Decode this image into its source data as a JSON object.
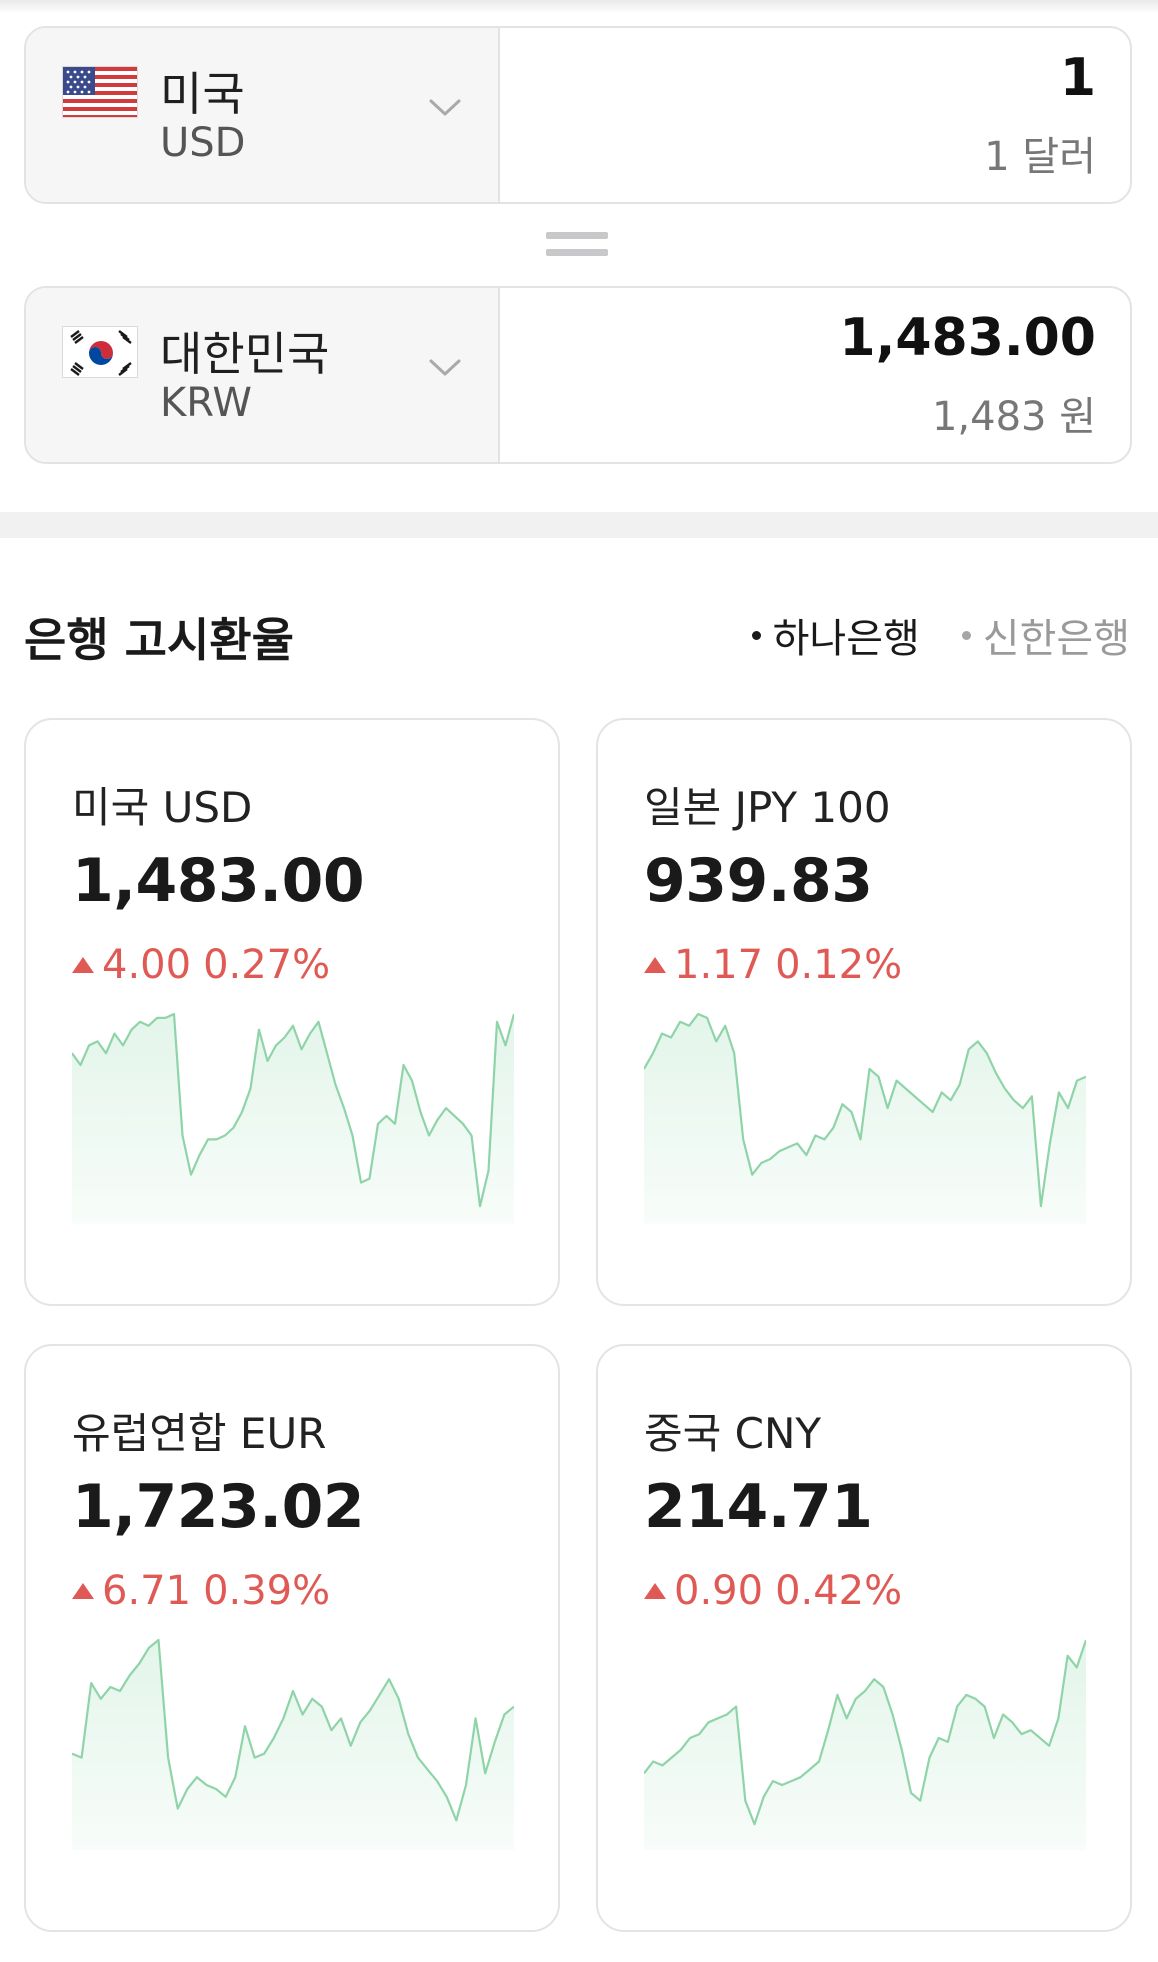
{
  "converter": {
    "from": {
      "country": "미국",
      "code": "USD",
      "amount": "1",
      "amount_text": "1 달러",
      "flag_icon": "us-flag-icon"
    },
    "to": {
      "country": "대한민국",
      "code": "KRW",
      "amount": "1,483.00",
      "amount_text": "1,483 원",
      "flag_icon": "kr-flag-icon"
    }
  },
  "rates_section": {
    "title": "은행 고시환율",
    "banks": [
      {
        "label": "하나은행",
        "active": true
      },
      {
        "label": "신한은행",
        "active": false
      }
    ]
  },
  "cards": [
    {
      "title": "미국 USD",
      "rate": "1,483.00",
      "change": "4.00",
      "change_pct": "0.27%",
      "direction": "up",
      "trend": [
        0.8,
        0.74,
        0.84,
        0.86,
        0.8,
        0.9,
        0.84,
        0.92,
        0.96,
        0.94,
        0.98,
        0.98,
        1.0,
        0.38,
        0.18,
        0.28,
        0.36,
        0.36,
        0.38,
        0.42,
        0.5,
        0.62,
        0.92,
        0.76,
        0.84,
        0.88,
        0.94,
        0.82,
        0.9,
        0.96,
        0.8,
        0.64,
        0.52,
        0.38,
        0.14,
        0.16,
        0.44,
        0.48,
        0.44,
        0.74,
        0.66,
        0.5,
        0.38,
        0.46,
        0.52,
        0.48,
        0.44,
        0.38,
        0.02,
        0.2,
        0.96,
        0.84,
        1.0
      ],
      "color_line": "#8fd4a8",
      "color_fill": "#e3f5ea"
    },
    {
      "title": "일본 JPY 100",
      "rate": "939.83",
      "change": "1.17",
      "change_pct": "0.12%",
      "direction": "up",
      "trend": [
        0.72,
        0.8,
        0.9,
        0.88,
        0.96,
        0.94,
        1.0,
        0.98,
        0.86,
        0.94,
        0.8,
        0.36,
        0.18,
        0.24,
        0.26,
        0.3,
        0.32,
        0.34,
        0.28,
        0.38,
        0.36,
        0.42,
        0.54,
        0.5,
        0.36,
        0.72,
        0.68,
        0.52,
        0.66,
        0.62,
        0.58,
        0.54,
        0.5,
        0.6,
        0.56,
        0.64,
        0.82,
        0.86,
        0.8,
        0.7,
        0.62,
        0.56,
        0.52,
        0.58,
        0.02,
        0.34,
        0.6,
        0.52,
        0.66,
        0.68
      ],
      "color_line": "#8fd4a8",
      "color_fill": "#e3f5ea"
    },
    {
      "title": "유럽연합 EUR",
      "rate": "1,723.02",
      "change": "6.71",
      "change_pct": "0.39%",
      "direction": "up",
      "trend": [
        0.42,
        0.4,
        0.78,
        0.7,
        0.76,
        0.74,
        0.82,
        0.88,
        0.96,
        1.0,
        0.4,
        0.14,
        0.24,
        0.3,
        0.26,
        0.24,
        0.2,
        0.3,
        0.56,
        0.4,
        0.42,
        0.5,
        0.6,
        0.74,
        0.62,
        0.7,
        0.66,
        0.54,
        0.6,
        0.46,
        0.58,
        0.64,
        0.72,
        0.8,
        0.7,
        0.52,
        0.4,
        0.34,
        0.28,
        0.2,
        0.08,
        0.26,
        0.6,
        0.32,
        0.48,
        0.62,
        0.66
      ],
      "color_line": "#8fd4a8",
      "color_fill": "#e3f5ea"
    },
    {
      "title": "중국 CNY",
      "rate": "214.71",
      "change": "0.90",
      "change_pct": "0.42%",
      "direction": "up",
      "trend": [
        0.32,
        0.38,
        0.36,
        0.4,
        0.44,
        0.5,
        0.52,
        0.58,
        0.6,
        0.62,
        0.66,
        0.18,
        0.06,
        0.2,
        0.28,
        0.26,
        0.28,
        0.3,
        0.34,
        0.38,
        0.54,
        0.72,
        0.6,
        0.7,
        0.74,
        0.8,
        0.76,
        0.62,
        0.44,
        0.22,
        0.18,
        0.4,
        0.5,
        0.48,
        0.66,
        0.72,
        0.7,
        0.66,
        0.5,
        0.62,
        0.58,
        0.52,
        0.54,
        0.5,
        0.46,
        0.6,
        0.92,
        0.86,
        1.0
      ],
      "color_line": "#8fd4a8",
      "color_fill": "#e3f5ea"
    }
  ]
}
